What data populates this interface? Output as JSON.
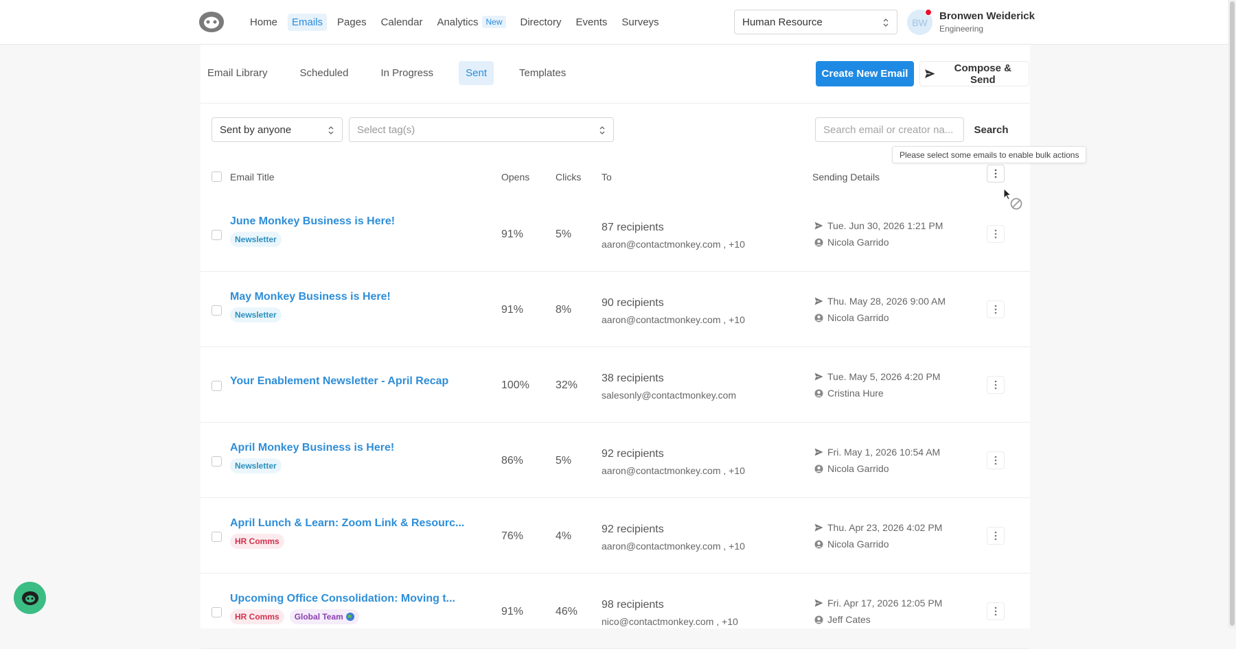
{
  "nav": {
    "items": [
      {
        "label": "Home",
        "active": false,
        "badge": ""
      },
      {
        "label": "Emails",
        "active": true,
        "badge": ""
      },
      {
        "label": "Pages",
        "active": false,
        "badge": ""
      },
      {
        "label": "Calendar",
        "active": false,
        "badge": ""
      },
      {
        "label": "Analytics",
        "active": false,
        "badge": "New"
      },
      {
        "label": "Directory",
        "active": false,
        "badge": ""
      },
      {
        "label": "Events",
        "active": false,
        "badge": ""
      },
      {
        "label": "Surveys",
        "active": false,
        "badge": ""
      }
    ],
    "org_select": "Human Resource"
  },
  "user": {
    "initials": "BW",
    "name": "Bronwen Weiderick",
    "dept": "Engineering"
  },
  "tabs": [
    {
      "label": "Email Library",
      "active": false
    },
    {
      "label": "Scheduled",
      "active": false
    },
    {
      "label": "In Progress",
      "active": false
    },
    {
      "label": "Sent",
      "active": true
    },
    {
      "label": "Templates",
      "active": false
    }
  ],
  "actions": {
    "create_label": "Create New Email",
    "compose_label": "Compose & Send"
  },
  "filters": {
    "sender": "Sent by anyone",
    "tags_placeholder": "Select tag(s)",
    "search_placeholder": "Search email or creator na...",
    "search_label": "Search"
  },
  "tooltip": "Please select some emails to enable bulk actions",
  "table": {
    "headers": {
      "title": "Email Title",
      "opens": "Opens",
      "clicks": "Clicks",
      "to": "To",
      "sending": "Sending Details"
    },
    "rows": [
      {
        "title": "June Monkey Business is Here!",
        "tags": [
          {
            "label": "Newsletter",
            "kind": "newsletter"
          }
        ],
        "opens": "91%",
        "clicks": "5%",
        "recipients": "87 recipients",
        "to": "aaron@contactmonkey.com , +10",
        "date": "Tue. Jun 30, 2026 1:21 PM",
        "sender": "Nicola Garrido"
      },
      {
        "title": "May Monkey Business is Here!",
        "tags": [
          {
            "label": "Newsletter",
            "kind": "newsletter"
          }
        ],
        "opens": "91%",
        "clicks": "8%",
        "recipients": "90 recipients",
        "to": "aaron@contactmonkey.com , +10",
        "date": "Thu. May 28, 2026 9:00 AM",
        "sender": "Nicola Garrido"
      },
      {
        "title": "Your Enablement Newsletter - April Recap",
        "tags": [],
        "opens": "100%",
        "clicks": "32%",
        "recipients": "38 recipients",
        "to": "salesonly@contactmonkey.com",
        "date": "Tue. May 5, 2026 4:20 PM",
        "sender": "Cristina Hure"
      },
      {
        "title": "April Monkey Business is Here!",
        "tags": [
          {
            "label": "Newsletter",
            "kind": "newsletter"
          }
        ],
        "opens": "86%",
        "clicks": "5%",
        "recipients": "92 recipients",
        "to": "aaron@contactmonkey.com , +10",
        "date": "Fri. May 1, 2026 10:54 AM",
        "sender": "Nicola Garrido"
      },
      {
        "title": "April Lunch & Learn: Zoom Link & Resourc...",
        "tags": [
          {
            "label": "HR Comms",
            "kind": "hr"
          }
        ],
        "opens": "76%",
        "clicks": "4%",
        "recipients": "92 recipients",
        "to": "aaron@contactmonkey.com , +10",
        "date": "Thu. Apr 23, 2026 4:02 PM",
        "sender": "Nicola Garrido"
      },
      {
        "title": "Upcoming Office Consolidation: Moving t...",
        "tags": [
          {
            "label": "HR Comms",
            "kind": "hr"
          },
          {
            "label": "Global Team",
            "kind": "global"
          }
        ],
        "opens": "91%",
        "clicks": "46%",
        "recipients": "98 recipients",
        "to": "nico@contactmonkey.com , +10",
        "date": "Fri. Apr 17, 2026 12:05 PM",
        "sender": "Jeff Cates"
      }
    ]
  },
  "icons": {
    "logo": "monkey-logo-icon",
    "send": "paper-plane-icon",
    "person": "person-icon",
    "more": "kebab-icon",
    "help": "help-chat-icon"
  },
  "colors": {
    "accent": "#1f8ae3",
    "link": "#2e8ed8",
    "help": "#3bbd84",
    "notify": "#e8112d"
  }
}
